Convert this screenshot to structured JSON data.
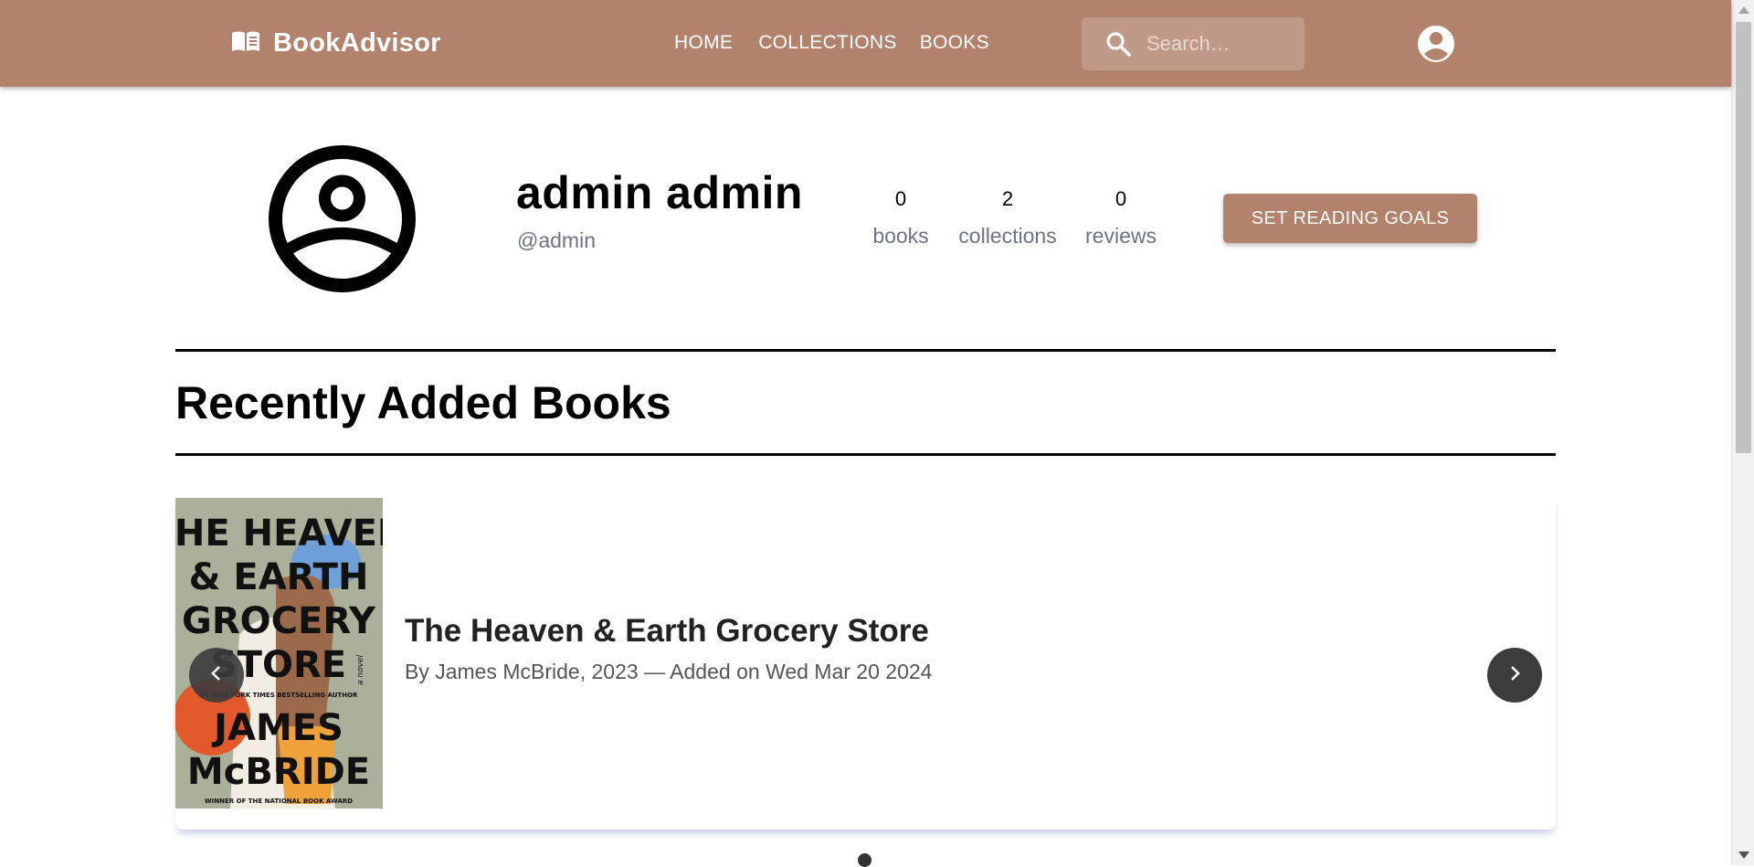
{
  "header": {
    "brand": "BookAdvisor",
    "nav": [
      "HOME",
      "COLLECTIONS",
      "BOOKS"
    ],
    "search_placeholder": "Search…"
  },
  "profile": {
    "name": "admin admin",
    "username": "@admin",
    "stats": [
      {
        "value": "0",
        "label": "books"
      },
      {
        "value": "2",
        "label": "collections"
      },
      {
        "value": "0",
        "label": "reviews"
      }
    ],
    "goals_button": "SET READING GOALS"
  },
  "section": {
    "title": "Recently Added Books"
  },
  "carousel": {
    "book": {
      "title": "The Heaven & Earth Grocery Store",
      "meta": "By James McBride, 2023 — Added on Wed Mar 20 2024",
      "cover_lines": [
        "THE HEAVEN",
        "& EARTH",
        "GROCERY",
        "STORE",
        "JAMES",
        "McBRIDE"
      ],
      "cover_tagline_top": "#1 NEW YORK TIMES BESTSELLING AUTHOR",
      "cover_tagline_bottom": "WINNER OF THE NATIONAL BOOK AWARD",
      "cover_side": "a novel"
    },
    "active_index": 0
  },
  "colors": {
    "brand": "#b2826d",
    "muted_text": "#6d7381",
    "carousel_button": "#3c3c3c"
  },
  "icons": {
    "brand": "book-open-icon",
    "search": "search-icon",
    "account": "account-circle-icon",
    "prev": "chevron-left-icon",
    "next": "chevron-right-icon"
  }
}
